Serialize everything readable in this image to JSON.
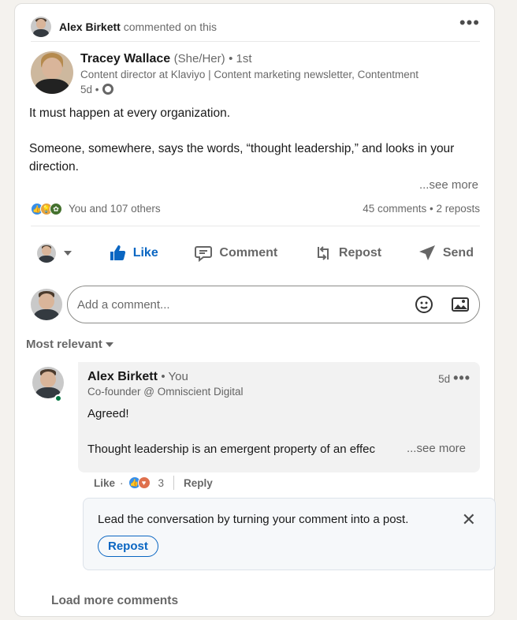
{
  "activity": {
    "actor": "Alex Birkett",
    "action": "commented on this"
  },
  "post": {
    "author": "Tracey Wallace",
    "pronouns": "(She/Her)",
    "degree": "• 1st",
    "headline": "Content director at Klaviyo | Content marketing newsletter, Contentment",
    "age": "5d •",
    "paragraphs": [
      "It must happen at every organization.",
      "Someone, somewhere, says the words, “thought leadership,” and looks in your direction."
    ],
    "see_more": "...see more"
  },
  "social": {
    "reactions": "You and 107 others",
    "counts": "45 comments • 2 reposts"
  },
  "actions": {
    "like": "Like",
    "comment": "Comment",
    "repost": "Repost",
    "send": "Send"
  },
  "composer": {
    "placeholder": "Add a comment..."
  },
  "sort": {
    "label": "Most relevant"
  },
  "comment": {
    "author": "Alex Birkett",
    "tag": "• You",
    "headline": "Co-founder @ Omniscient Digital",
    "age": "5d",
    "line1": "Agreed!",
    "line2": "Thought leadership is an emergent property of an effec",
    "see_more": "...see more",
    "like": "Like",
    "dot": "·",
    "reaction_count": "3",
    "reply": "Reply"
  },
  "promo": {
    "text": "Lead the conversation by turning your comment into a post.",
    "button": "Repost"
  },
  "load_more": "Load more comments",
  "colors": {
    "brand": "#0a66c2",
    "online": "#057642"
  }
}
